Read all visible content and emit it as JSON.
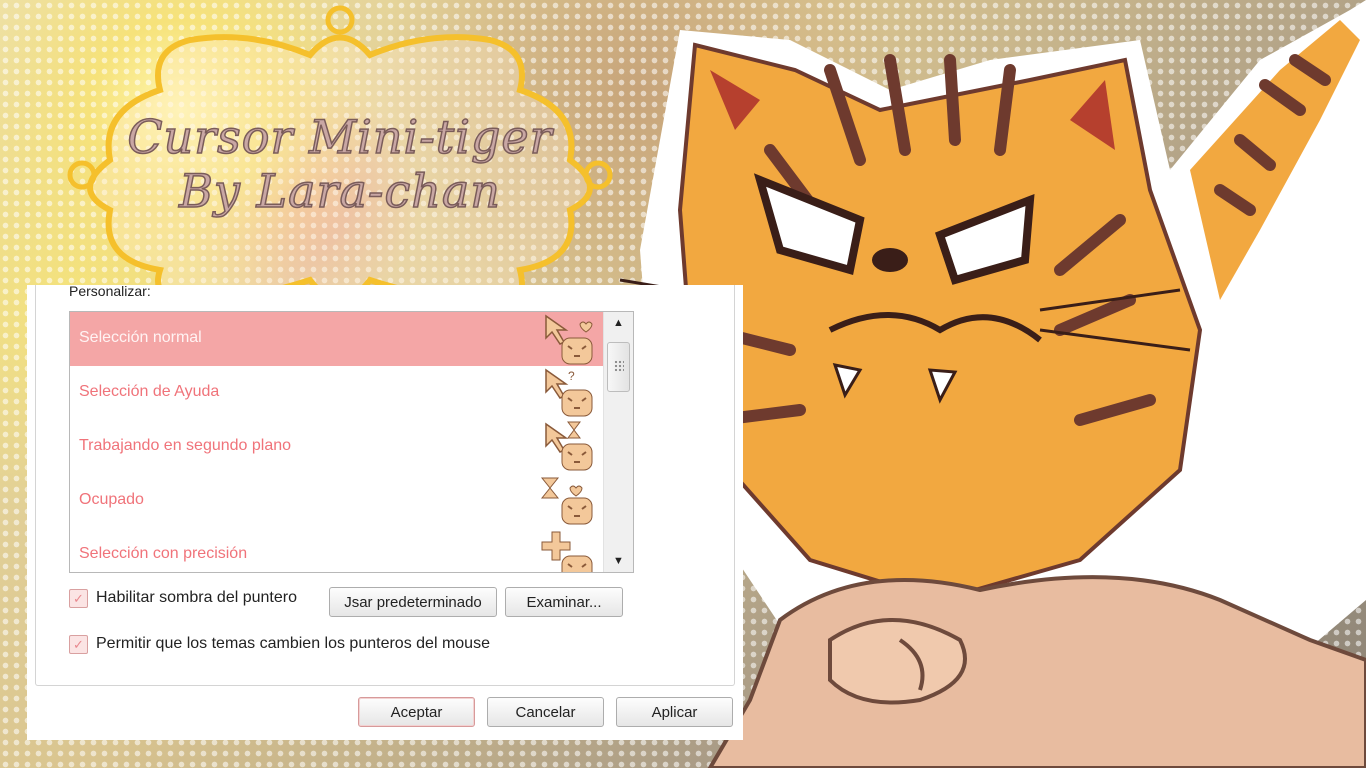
{
  "background": {
    "accent_yellow": "#f6e27a",
    "tiger_orange": "#f2a840",
    "tiger_stripes": "#6e3a2e"
  },
  "title": {
    "line1": "Cursor Mini-tiger",
    "line2": "By Lara-chan",
    "frame_color": "#f5c02c",
    "text_color": "#c9a7a4"
  },
  "dialog": {
    "group_label": "Personalizar:",
    "cursor_list": [
      {
        "label": "Selección normal",
        "icon": "arrow-heart-tiger-icon",
        "selected": true
      },
      {
        "label": "Selección de Ayuda",
        "icon": "arrow-question-tiger-icon",
        "selected": false
      },
      {
        "label": "Trabajando en segundo plano",
        "icon": "arrow-hourglass-tiger-icon",
        "selected": false
      },
      {
        "label": "Ocupado",
        "icon": "hourglass-heart-tiger-icon",
        "selected": false
      },
      {
        "label": "Selección con precisión",
        "icon": "crosshair-tiger-icon",
        "selected": false
      }
    ],
    "list_text_color": "#f0737a",
    "selected_row_color": "#f4a6a6",
    "shadow_checkbox": {
      "label": "Habilitar sombra del puntero",
      "checked": true
    },
    "themes_checkbox": {
      "label": "Permitir que los temas cambien los punteros del mouse",
      "checked": true
    },
    "use_default_button": "Jsar predeterminado",
    "browse_button": "Examinar...",
    "ok_button": "Aceptar",
    "cancel_button": "Cancelar",
    "apply_button": "Aplicar"
  }
}
